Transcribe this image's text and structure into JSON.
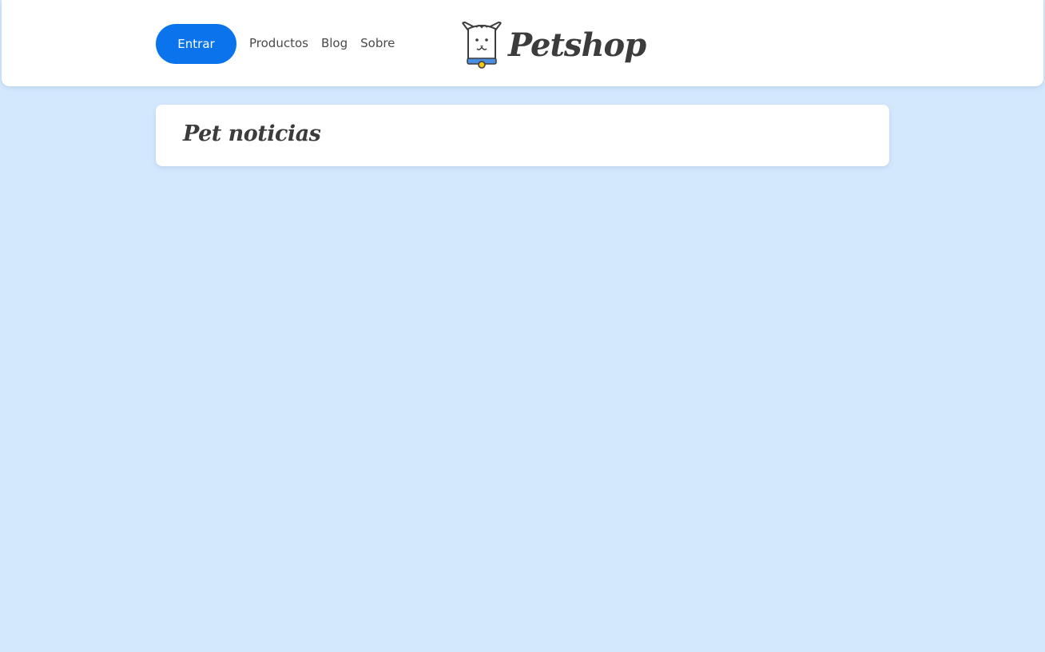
{
  "header": {
    "login_label": "Entrar",
    "nav": {
      "productos": "Productos",
      "blog": "Blog",
      "sobre": "Sobre"
    },
    "logo": {
      "icon": "dog-icon",
      "text": "Petshop"
    }
  },
  "main": {
    "section_title": "Pet noticias"
  },
  "colors": {
    "accent": "#0b74ec",
    "background": "#d4e8fd",
    "text": "#3c3c3c"
  }
}
